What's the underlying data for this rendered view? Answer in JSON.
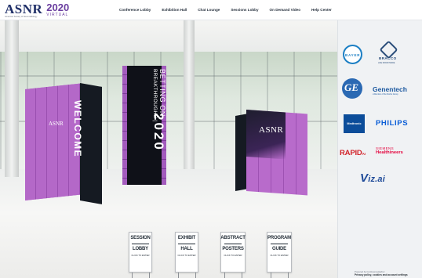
{
  "header": {
    "logo": {
      "wordmark": "ASNR",
      "subtitle": "American Society of Neuroradiology",
      "year": "2020",
      "edition": "VIRTUAL"
    },
    "nav": [
      {
        "label": "Conference Lobby"
      },
      {
        "label": "Exhibition Hall"
      },
      {
        "label": "Chat Lounge"
      },
      {
        "label": "Sessions Lobby"
      },
      {
        "label": "On Demand Video"
      },
      {
        "label": "Help Center"
      }
    ]
  },
  "lobby": {
    "banners": {
      "welcome": {
        "side_text": "WELCOME",
        "front_logo": "ASNR"
      },
      "center": {
        "line1": "BETTING ON",
        "line2": "BREAKTHROUGHS |",
        "line3": "2020"
      },
      "right": {
        "logo": "ASNR"
      }
    },
    "signs": [
      {
        "line1": "SESSION",
        "line2": "LOBBY",
        "cta": "CLICK TO ENTER"
      },
      {
        "line1": "EXHIBIT",
        "line2": "HALL",
        "cta": "CLICK TO ENTER"
      },
      {
        "line1": "ABSTRACT",
        "line2": "POSTERS",
        "cta": "CLICK TO ENTER"
      },
      {
        "line1": "PROGRAM",
        "line2": "GUIDE",
        "cta": "CLICK TO ENTER"
      }
    ]
  },
  "sponsors": {
    "bayer": {
      "name": "BAYER"
    },
    "bracco": {
      "name": "BRACCO",
      "tagline": "LIFE FROM INSIDE"
    },
    "ge": {
      "name": "GE"
    },
    "genentech": {
      "name": "Genentech",
      "tagline": "A Member of the Roche Group"
    },
    "medtronic": {
      "name": "Medtronic"
    },
    "philips": {
      "name": "PHILIPS"
    },
    "rapid": {
      "name": "RAPID",
      "suffix": "AI"
    },
    "siemens": {
      "top": "SIEMENS",
      "bottom": "Healthineers"
    },
    "vizai": {
      "v": "V",
      "rest": "iz.ai"
    },
    "footer": {
      "powered": "Powered by ConferenceHarbor",
      "policy": "Privacy policy, cookies and account settings"
    }
  },
  "colors": {
    "brand_navy": "#1f2f68",
    "brand_purple": "#6b3fa0",
    "banner_purple": "#b468c8"
  }
}
